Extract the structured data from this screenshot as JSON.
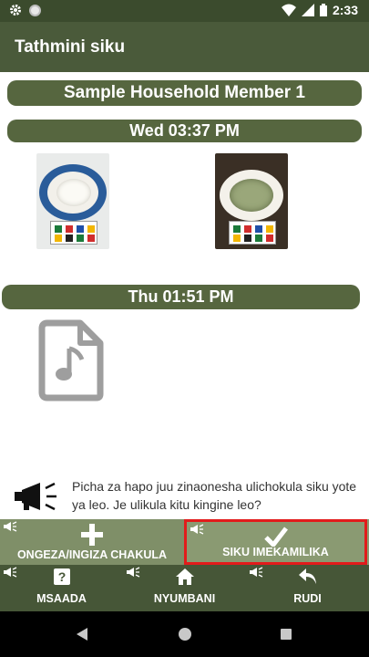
{
  "status_bar": {
    "time": "2:33",
    "icons": [
      "gear-icon",
      "circle-icon",
      "wifi-icon",
      "signal-icon",
      "battery-icon"
    ]
  },
  "app_bar": {
    "title": "Tathmini siku"
  },
  "member": {
    "name": "Sample Household Member 1"
  },
  "meals": [
    {
      "time_label": "Wed 03:37 PM",
      "photos": [
        "plate-photo-rice",
        "plate-photo-greens"
      ]
    },
    {
      "time_label": "Thu 01:51 PM",
      "attachment_icon": "audio-file-icon"
    }
  ],
  "tip": {
    "text": "Picha za hapo juu zinaonesha ulichokula siku yote ya leo. Je ulikula kitu kingine leo?"
  },
  "actions": {
    "add_food_label": "ONGEZA/INGIZA CHAKULA",
    "day_complete_label": "SIKU IMEKAMILIKA"
  },
  "nav": {
    "help_label": "MSAADA",
    "home_label": "NYUMBANI",
    "back_label": "RUDI"
  },
  "colors": {
    "status_bar": "#3b4b2d",
    "app_bar": "#4a5a3a",
    "pill": "#56663f",
    "action_bar": "#8a9a72",
    "nav_bar": "#465637",
    "highlight": "#e21b1b"
  }
}
